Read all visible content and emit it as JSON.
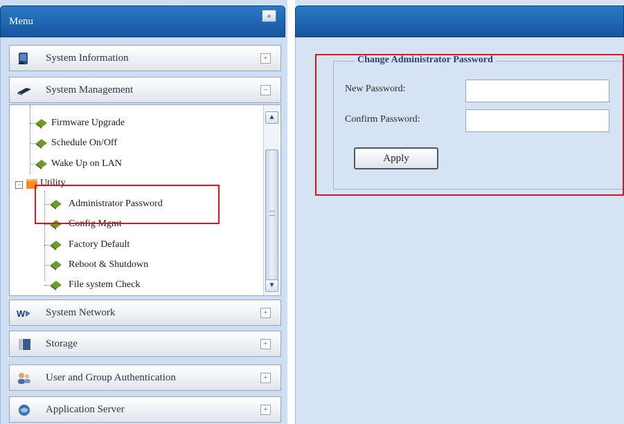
{
  "menu": {
    "title": "Menu",
    "collapse_label": "«",
    "sections_top": [
      {
        "label": "System Information",
        "toggle": "+",
        "icon": "system-information-icon"
      },
      {
        "label": "System Management",
        "toggle": "−",
        "icon": "system-management-icon"
      }
    ],
    "tree": {
      "items": [
        {
          "label": "Firmware Upgrade"
        },
        {
          "label": "Schedule On/Off"
        },
        {
          "label": "Wake Up on LAN"
        }
      ],
      "utility": {
        "label": "Utility",
        "expander": "−",
        "children": [
          {
            "label": "Administrator Password"
          },
          {
            "label": "Config Mgmt"
          },
          {
            "label": "Factory Default"
          },
          {
            "label": "Reboot & Shutdown"
          },
          {
            "label": "File system Check"
          }
        ]
      },
      "scroll_up": "▲",
      "scroll_down": "▼"
    },
    "sections_bottom": [
      {
        "label": "System Network",
        "toggle": "+",
        "icon": "system-network-icon"
      },
      {
        "label": "Storage",
        "toggle": "+",
        "icon": "storage-icon"
      },
      {
        "label": "User and Group Authentication",
        "toggle": "+",
        "icon": "user-group-icon"
      },
      {
        "label": "Application Server",
        "toggle": "+",
        "icon": "application-server-icon"
      }
    ]
  },
  "form": {
    "legend": "Change Administrator Password",
    "new_password_label": "New Password:",
    "new_password_value": "",
    "confirm_password_label": "Confirm Password:",
    "confirm_password_value": "",
    "apply_label": "Apply"
  },
  "colors": {
    "header_blue": "#1f66b1",
    "panel_bg": "#d5e3f5",
    "highlight_red": "#e0141e",
    "leaf_green": "#6f9a2b"
  }
}
